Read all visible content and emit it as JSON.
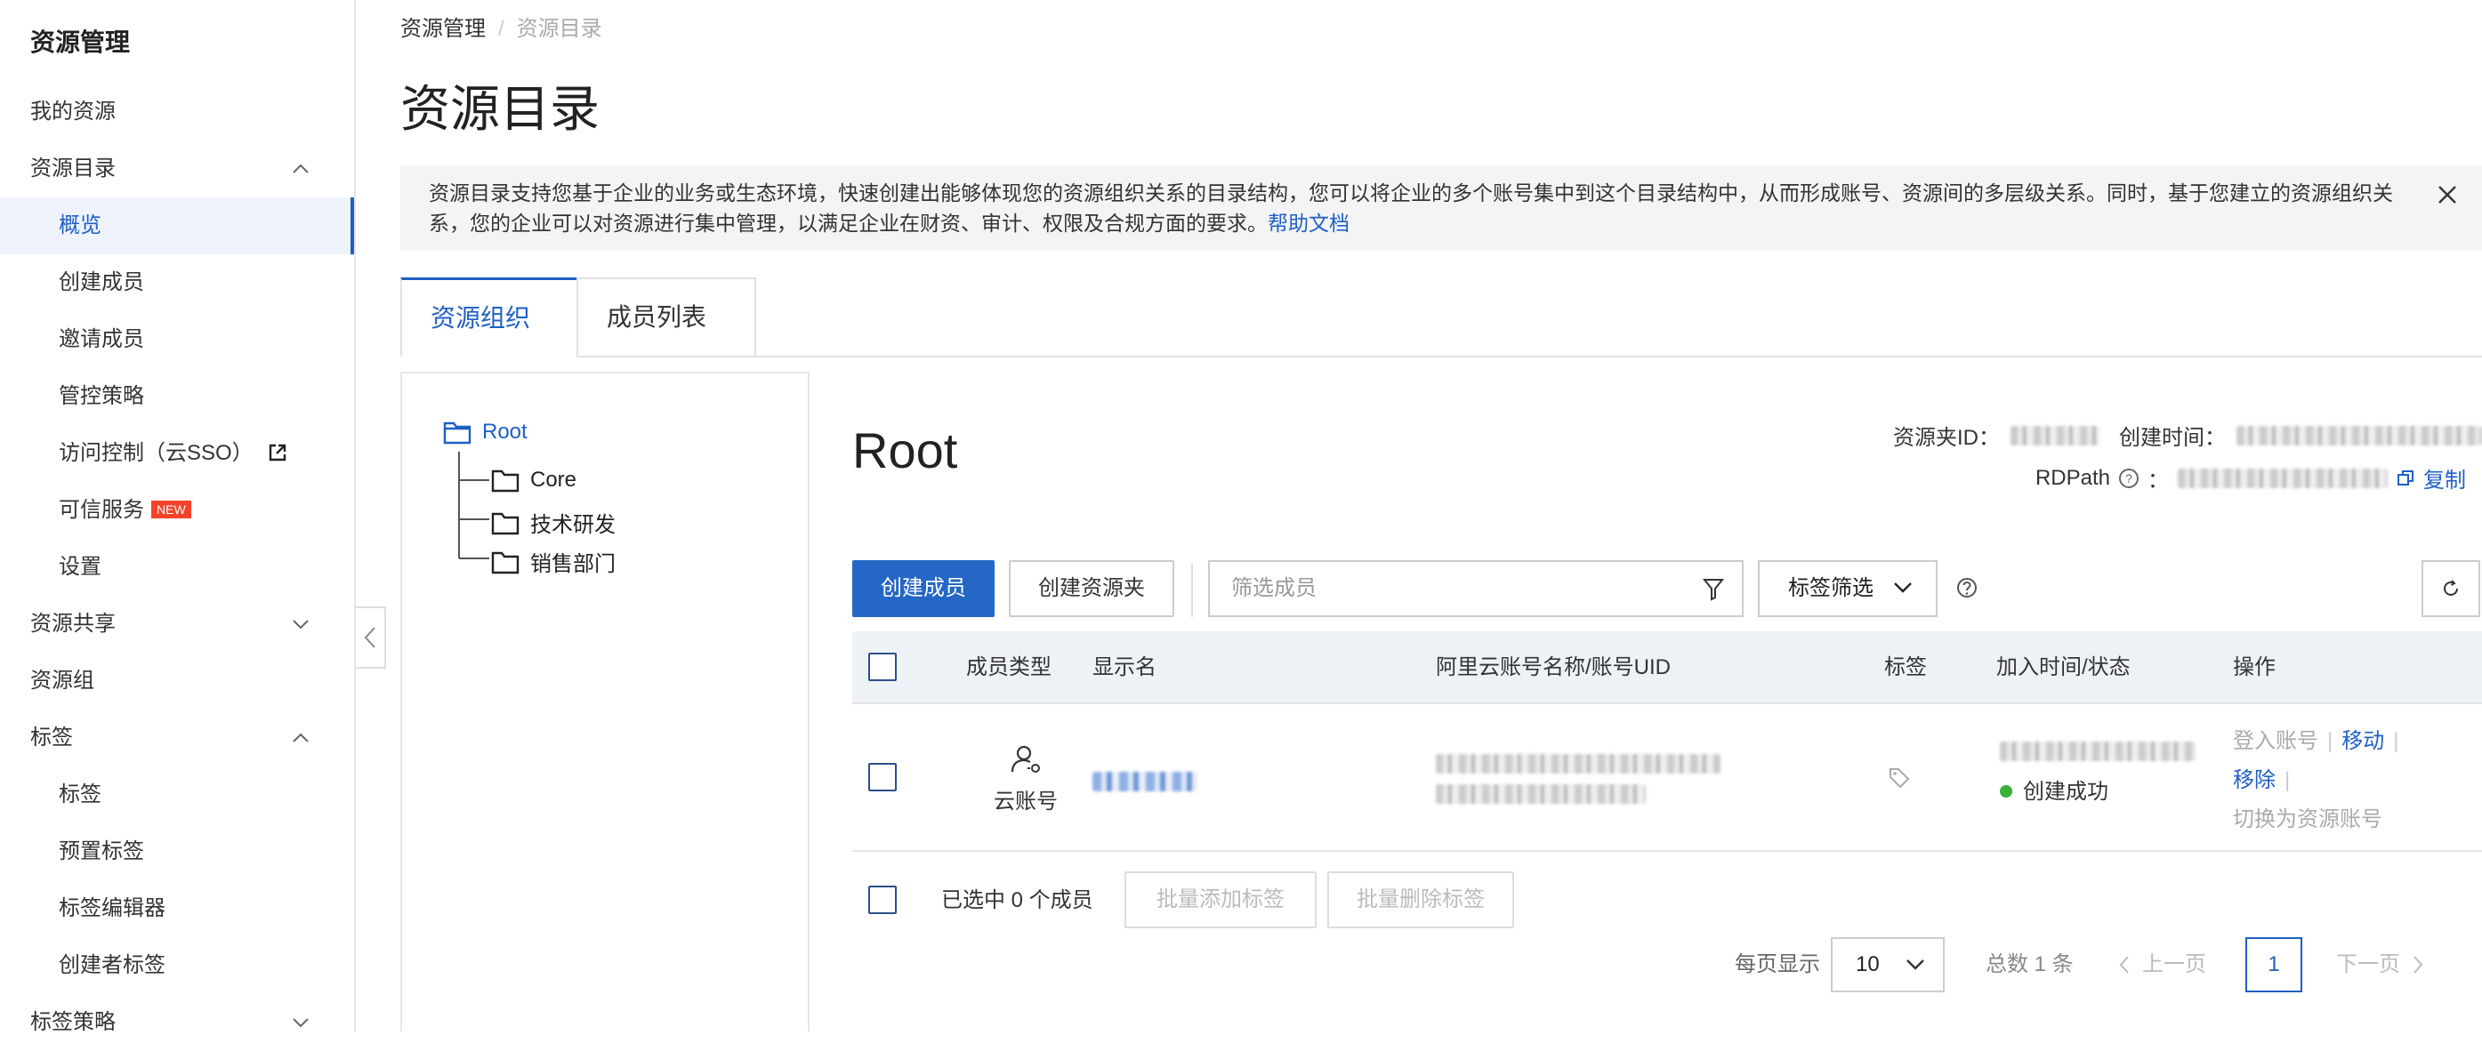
{
  "sidebar": {
    "title": "资源管理",
    "items": [
      {
        "label": "我的资源"
      },
      {
        "label": "资源目录"
      },
      {
        "label": "概览"
      },
      {
        "label": "创建成员"
      },
      {
        "label": "邀请成员"
      },
      {
        "label": "管控策略"
      },
      {
        "label": "访问控制（云SSO）"
      },
      {
        "label": "可信服务",
        "badge": "NEW"
      },
      {
        "label": "设置"
      },
      {
        "label": "资源共享"
      },
      {
        "label": "资源组"
      },
      {
        "label": "标签"
      },
      {
        "label": "标签"
      },
      {
        "label": "预置标签"
      },
      {
        "label": "标签编辑器"
      },
      {
        "label": "创建者标签"
      },
      {
        "label": "标签策略"
      }
    ]
  },
  "breadcrumb": {
    "root": "资源管理",
    "separator": "/",
    "current": "资源目录"
  },
  "page_title": "资源目录",
  "notice": {
    "text": "资源目录支持您基于企业的业务或生态环境，快速创建出能够体现您的资源组织关系的目录结构，您可以将企业的多个账号集中到这个目录结构中，从而形成账号、资源间的多层级关系。同时，基于您建立的资源组织关系，您的企业可以对资源进行集中管理，以满足企业在财资、审计、权限及合规方面的要求。",
    "link": "帮助文档"
  },
  "tabs": [
    {
      "label": "资源组织"
    },
    {
      "label": "成员列表"
    }
  ],
  "tree": {
    "root": "Root",
    "children": [
      {
        "label": "Core"
      },
      {
        "label": "技术研发"
      },
      {
        "label": "销售部门"
      }
    ]
  },
  "folder": {
    "title": "Root",
    "id_label": "资源夹ID：",
    "created_label": "创建时间：",
    "rdpath_label": "RDPath",
    "copy_label": "复制"
  },
  "toolbar": {
    "create_member": "创建成员",
    "create_folder": "创建资源夹",
    "search_placeholder": "筛选成员",
    "tag_filter": "标签筛选"
  },
  "table": {
    "headers": [
      "成员类型",
      "显示名",
      "阿里云账号名称/账号UID",
      "标签",
      "加入时间/状态",
      "操作"
    ],
    "rows": [
      {
        "type": "云账号",
        "status": "创建成功",
        "ops": {
          "login": "登入账号",
          "move": "移动",
          "remove": "移除",
          "switch": "切换为资源账号"
        }
      }
    ]
  },
  "bulk": {
    "selected": "已选中 0 个成员",
    "add_tags": "批量添加标签",
    "remove_tags": "批量删除标签"
  },
  "pagination": {
    "per_page_label": "每页显示",
    "per_page_value": "10",
    "total": "总数 1 条",
    "prev": "上一页",
    "current_page": "1",
    "next": "下一页"
  },
  "colors": {
    "accent": "#1f5fc4",
    "primary_button": "#2467c6",
    "success": "#3cae3a",
    "new_badge": "#f5432a"
  },
  "icons": [
    "chevron-up-icon",
    "chevron-down-icon",
    "external-link-icon",
    "close-icon",
    "folder-icon",
    "filter-icon",
    "help-icon",
    "refresh-icon",
    "user-key-icon",
    "tag-icon",
    "copy-icon",
    "chevron-left-icon",
    "chevron-right-icon"
  ]
}
